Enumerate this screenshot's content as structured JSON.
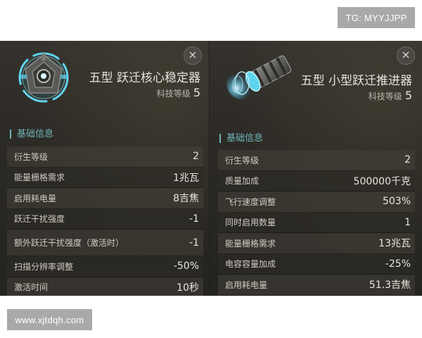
{
  "watermarks": {
    "top": "TG: MYYJJPP",
    "bottom": "www.xjtdqh.com"
  },
  "left_panel": {
    "title": "五型 跃迁核心稳定器",
    "tech_label": "科技等级",
    "tech_level": "5",
    "section": "基础信息",
    "close_symbol": "×",
    "icon": "warp-core-stabilizer-icon",
    "rows": [
      {
        "label": "衍生等级",
        "value": "2"
      },
      {
        "label": "能量栅格需求",
        "value": "1兆瓦"
      },
      {
        "label": "启用耗电量",
        "value": "8吉焦"
      },
      {
        "label": "跃迁干扰强度",
        "value": "-1"
      },
      {
        "label": "额外跃迁干扰强度（激活时）",
        "value": "-1"
      },
      {
        "label": "扫描分辨率调整",
        "value": "-50%"
      },
      {
        "label": "激活时间",
        "value": "10秒"
      }
    ]
  },
  "right_panel": {
    "title": "五型 小型跃迁推进器",
    "tech_label": "科技等级",
    "tech_level": "5",
    "section": "基础信息",
    "close_symbol": "×",
    "icon": "warp-thruster-icon",
    "rows": [
      {
        "label": "衍生等级",
        "value": "2"
      },
      {
        "label": "质量加成",
        "value": "500000千克"
      },
      {
        "label": "飞行速度调整",
        "value": "503%"
      },
      {
        "label": "同时启用数量",
        "value": "1"
      },
      {
        "label": "能量栅格需求",
        "value": "13兆瓦"
      },
      {
        "label": "电容容量加成",
        "value": "-25%"
      },
      {
        "label": "启用耗电量",
        "value": "51.3吉焦"
      }
    ]
  }
}
